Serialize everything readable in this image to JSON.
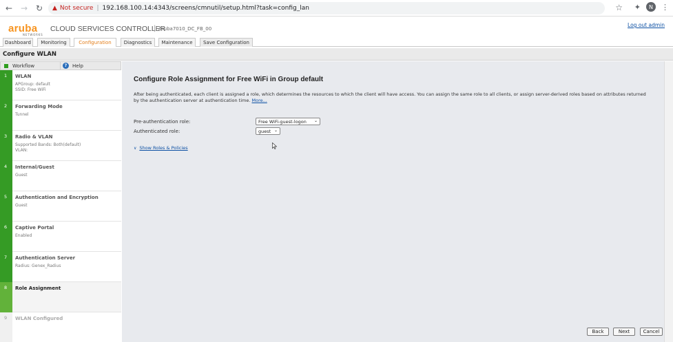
{
  "browser": {
    "security_label": "Not secure",
    "separator": "|",
    "url": "192.168.100.14:4343/screens/cmnutil/setup.html?task=config_lan",
    "profile_initial": "N"
  },
  "header": {
    "logo": "aruba",
    "logo_sub": "NETWORKS",
    "product": "CLOUD SERVICES CONTROLLER",
    "pipe": "|",
    "device": "Aruba7010_DC_FB_00",
    "logout": "Log out admin"
  },
  "tabs": [
    {
      "label": "Dashboard"
    },
    {
      "label": "Monitoring"
    },
    {
      "label": "Configuration"
    },
    {
      "label": "Diagnostics"
    },
    {
      "label": "Maintenance"
    },
    {
      "label": "Save Configuration"
    }
  ],
  "page": {
    "title": "Configure WLAN"
  },
  "sidebar": {
    "workflow_label": "Workflow",
    "help_label": "Help",
    "steps": [
      {
        "num": "1",
        "name": "WLAN",
        "sub1": "APGroup: default",
        "sub2": "SSID: Free WiFi"
      },
      {
        "num": "2",
        "name": "Forwarding Mode",
        "sub1": "Tunnel",
        "sub2": ""
      },
      {
        "num": "3",
        "name": "Radio & VLAN",
        "sub1": "Supported Bands: Both(default)",
        "sub2": "VLAN:"
      },
      {
        "num": "4",
        "name": "Internal/Guest",
        "sub1": "Guest",
        "sub2": ""
      },
      {
        "num": "5",
        "name": "Authentication and Encryption",
        "sub1": "Guest",
        "sub2": ""
      },
      {
        "num": "6",
        "name": "Captive Portal",
        "sub1": "Enabled",
        "sub2": ""
      },
      {
        "num": "7",
        "name": "Authentication Server",
        "sub1": "Radius: Genex_Radius",
        "sub2": ""
      },
      {
        "num": "8",
        "name": "Role Assignment",
        "sub1": "",
        "sub2": ""
      },
      {
        "num": "9",
        "name": "WLAN Configured",
        "sub1": "",
        "sub2": ""
      }
    ]
  },
  "main": {
    "heading": "Configure Role Assignment for Free WiFi in Group default",
    "description": "After being authenticated, each client is assigned a role, which determines the resources to which the client will have access. You can assign the same role to all clients, or assign server-derived roles based on attributes returned by the authentication server at authentication time.",
    "more_link": "More...",
    "pre_auth_label": "Pre-authentication role:",
    "pre_auth_value": "Free WiFi-guest-logon",
    "auth_label": "Authenticated role:",
    "auth_value": "guest",
    "show_roles": "Show Roles & Policies"
  },
  "buttons": {
    "back": "Back",
    "next": "Next",
    "cancel": "Cancel"
  }
}
